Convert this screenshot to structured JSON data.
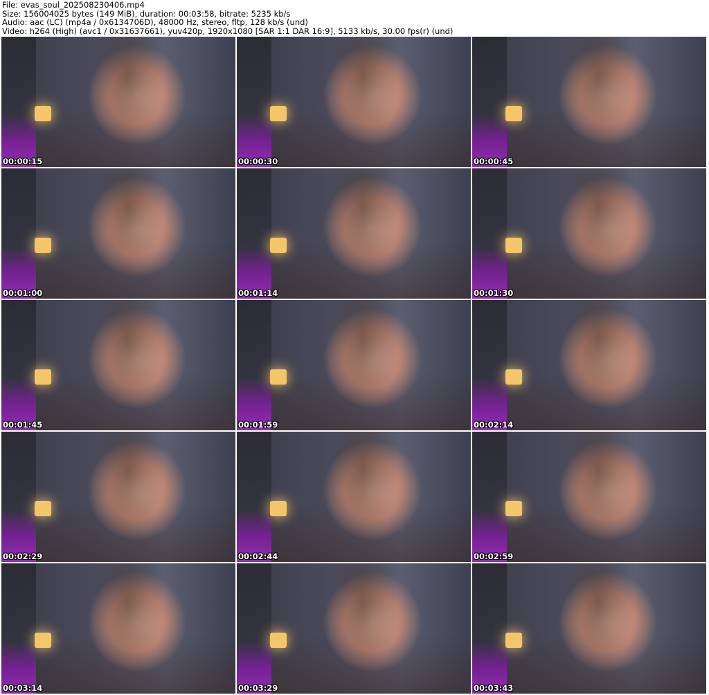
{
  "header": {
    "file": "File: evas_soul_202508230406.mp4",
    "size": "Size: 156004025 bytes (149 MiB), duration: 00:03:58, bitrate: 5235 kb/s",
    "audio": "Audio: aac (LC) (mp4a / 0x6134706D), 48000 Hz, stereo, fltp, 128 kb/s (und)",
    "video": "Video: h264 (High) (avc1 / 0x31637661), yuv420p, 1920x1080 [SAR 1:1 DAR 16:9], 5133 kb/s, 30.00 fps(r) (und)"
  },
  "thumbnails": [
    {
      "timestamp": "00:00:15"
    },
    {
      "timestamp": "00:00:30"
    },
    {
      "timestamp": "00:00:45"
    },
    {
      "timestamp": "00:01:00"
    },
    {
      "timestamp": "00:01:14"
    },
    {
      "timestamp": "00:01:30"
    },
    {
      "timestamp": "00:01:45"
    },
    {
      "timestamp": "00:01:59"
    },
    {
      "timestamp": "00:02:14"
    },
    {
      "timestamp": "00:02:29"
    },
    {
      "timestamp": "00:02:44"
    },
    {
      "timestamp": "00:02:59"
    },
    {
      "timestamp": "00:03:14"
    },
    {
      "timestamp": "00:03:29"
    },
    {
      "timestamp": "00:03:43"
    }
  ]
}
